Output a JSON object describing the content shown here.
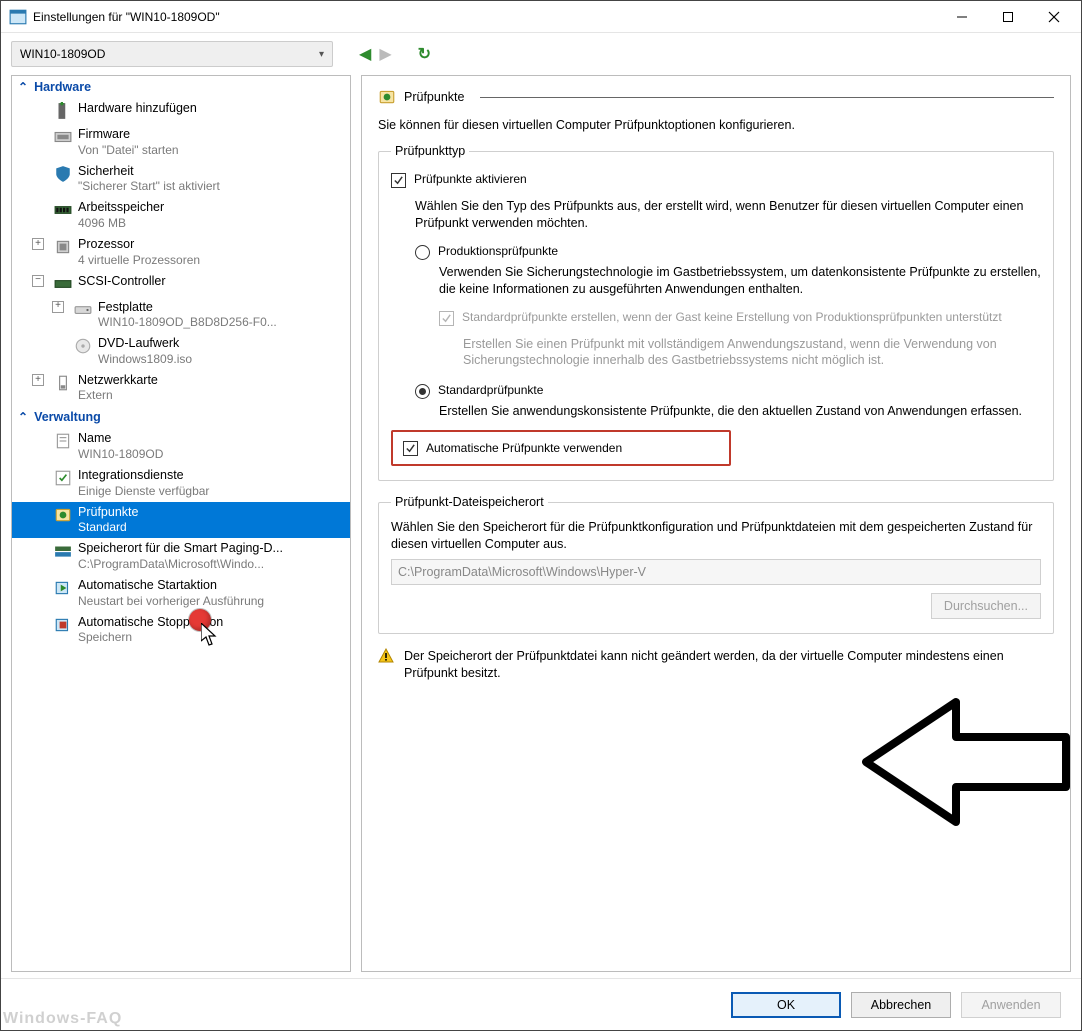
{
  "window": {
    "title": "Einstellungen für \"WIN10-1809OD\"",
    "vm_name": "WIN10-1809OD"
  },
  "sidebar": {
    "section_hardware": "Hardware",
    "section_management": "Verwaltung",
    "items": {
      "add_hw": {
        "label": "Hardware hinzufügen"
      },
      "firmware": {
        "label": "Firmware",
        "sub": "Von \"Datei\" starten"
      },
      "security": {
        "label": "Sicherheit",
        "sub": "\"Sicherer Start\" ist aktiviert"
      },
      "memory": {
        "label": "Arbeitsspeicher",
        "sub": "4096 MB"
      },
      "processor": {
        "label": "Prozessor",
        "sub": "4 virtuelle Prozessoren"
      },
      "scsi": {
        "label": "SCSI-Controller"
      },
      "hdd": {
        "label": "Festplatte",
        "sub": "WIN10-1809OD_B8D8D256-F0..."
      },
      "dvd": {
        "label": "DVD-Laufwerk",
        "sub": "Windows1809.iso"
      },
      "nic": {
        "label": "Netzwerkkarte",
        "sub": "Extern"
      },
      "name": {
        "label": "Name",
        "sub": "WIN10-1809OD"
      },
      "integration": {
        "label": "Integrationsdienste",
        "sub": "Einige Dienste verfügbar"
      },
      "checkpoints": {
        "label": "Prüfpunkte",
        "sub": "Standard"
      },
      "paging": {
        "label": "Speicherort für die Smart Paging-D...",
        "sub": "C:\\ProgramData\\Microsoft\\Windo..."
      },
      "autostart": {
        "label": "Automatische Startaktion",
        "sub": "Neustart bei vorheriger Ausführung"
      },
      "autostop": {
        "label": "Automatische Stoppaktion",
        "sub": "Speichern"
      }
    }
  },
  "pane": {
    "title": "Prüfpunkte",
    "intro": "Sie können für diesen virtuellen Computer Prüfpunktoptionen konfigurieren.",
    "group_type": "Prüfpunkttyp",
    "enable_label": "Prüfpunkte aktivieren",
    "type_hint": "Wählen Sie den Typ des Prüfpunkts aus, der erstellt wird, wenn Benutzer für diesen virtuellen Computer einen Prüfpunkt verwenden möchten.",
    "production_label": "Produktionsprüfpunkte",
    "production_desc": "Verwenden Sie Sicherungstechnologie im Gastbetriebssystem, um datenkonsistente Prüfpunkte zu erstellen, die keine Informationen zu ausgeführten Anwendungen enthalten.",
    "fallback_label": "Standardprüfpunkte erstellen, wenn der Gast keine Erstellung von Produktionsprüfpunkten unterstützt",
    "fallback_desc": "Erstellen Sie einen Prüfpunkt mit vollständigem Anwendungszustand, wenn die Verwendung von Sicherungstechnologie innerhalb des Gastbetriebssystems nicht möglich ist.",
    "standard_label": "Standardprüfpunkte",
    "standard_desc": "Erstellen Sie anwendungskonsistente Prüfpunkte, die den aktuellen Zustand von Anwendungen erfassen.",
    "auto_label": "Automatische Prüfpunkte verwenden",
    "group_location": "Prüfpunkt-Dateispeicherort",
    "location_hint": "Wählen Sie den Speicherort für die Prüfpunktkonfiguration und Prüfpunktdateien mit dem gespeicherten Zustand für diesen virtuellen Computer aus.",
    "location_value": "C:\\ProgramData\\Microsoft\\Windows\\Hyper-V",
    "browse_label": "Durchsuchen...",
    "warning": "Der Speicherort der Prüfpunktdatei kann nicht geändert werden, da der virtuelle Computer mindestens einen Prüfpunkt besitzt."
  },
  "footer": {
    "ok": "OK",
    "cancel": "Abbrechen",
    "apply": "Anwenden"
  },
  "watermark": "Windows-FAQ"
}
